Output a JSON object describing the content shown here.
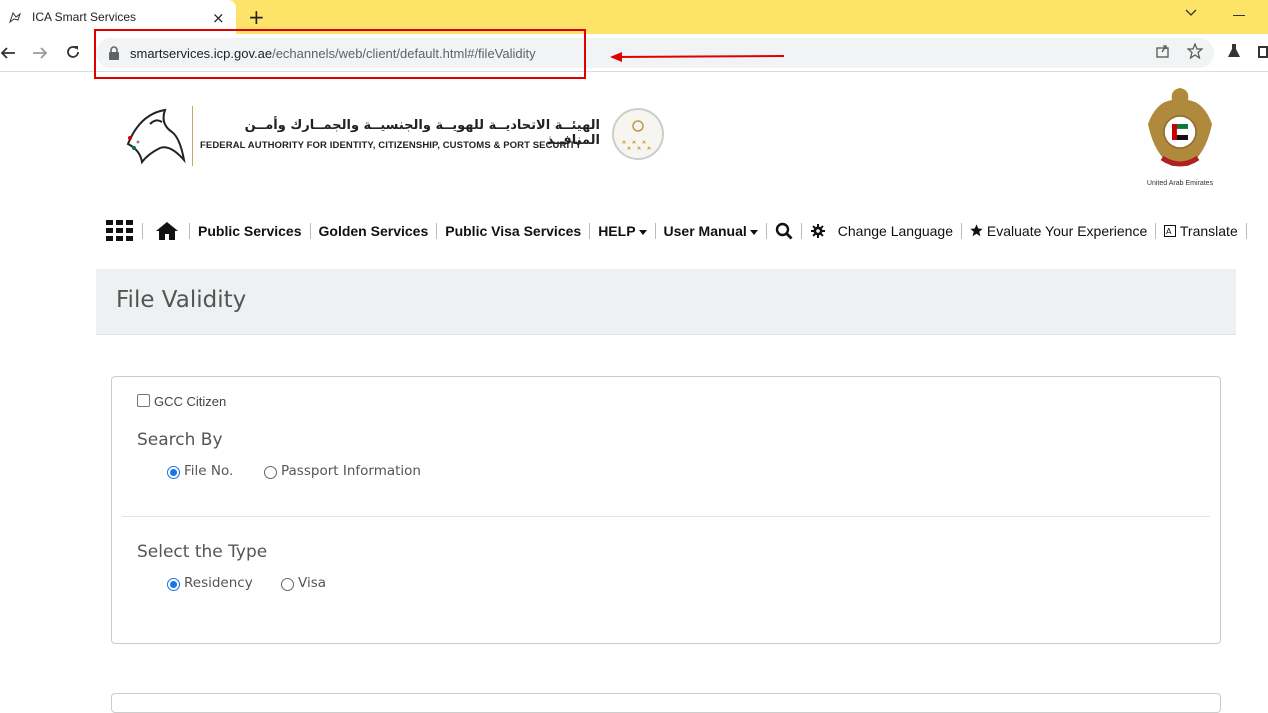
{
  "browser": {
    "tab_title": "ICA Smart Services",
    "tab_close": "×",
    "new_tab": "+",
    "url_host": "smartservices.icp.gov.ae",
    "url_path": "/echannels/web/client/default.html#/fileValidity",
    "annotation_color": "#e00000"
  },
  "header": {
    "org_name_arabic": "الهيئــة الاتحاديــة للهويــة والجنسيــة والجمــارك وأمــن المنافــذ",
    "org_name_english": "FEDERAL AUTHORITY FOR IDENTITY, CITIZENSHIP, CUSTOMS & PORT SECURITY",
    "emblem_caption": "United Arab Emirates"
  },
  "nav": {
    "items": [
      "Public Services",
      "Golden Services",
      "Public Visa Services",
      "HELP",
      "User Manual",
      "Change Language",
      "Evaluate Your Experience",
      "Translate"
    ]
  },
  "page": {
    "title": "File Validity"
  },
  "form": {
    "gcc_label": "GCC Citizen",
    "gcc_checked": false,
    "search_by_label": "Search By",
    "search_by_options": [
      "File No.",
      "Passport Information"
    ],
    "search_by_selected": "File No.",
    "type_label": "Select the Type",
    "type_options": [
      "Residency",
      "Visa"
    ],
    "type_selected": "Residency"
  }
}
